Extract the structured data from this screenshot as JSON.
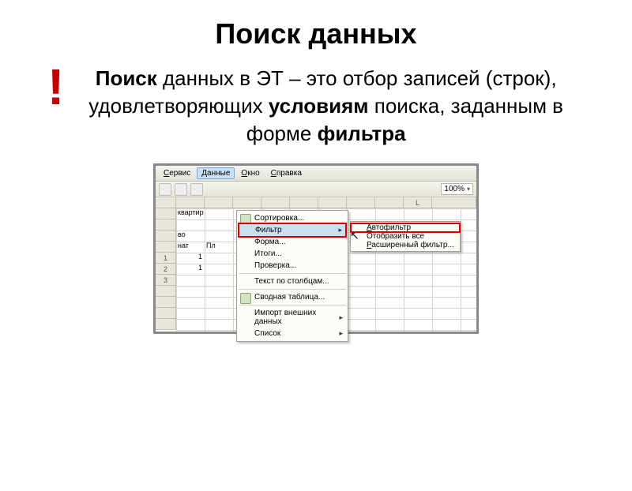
{
  "title": "Поиск данных",
  "bang": "!",
  "para_html": {
    "w1": "Поиск",
    "t1": " данных в ЭТ – это отбор записей (строк), удовлетворяющих ",
    "w2": "условиям",
    "t2": " поиска, заданным в форме ",
    "w3": "фильтра"
  },
  "menubar": {
    "service": "Сервис",
    "data": "Данные",
    "window": "Окно",
    "help": "Справка"
  },
  "zoom": "100%",
  "dropdown": {
    "sort": "Сортировка...",
    "filter": "Фильтр",
    "form": "Форма...",
    "totals": "Итоги...",
    "validate": "Проверка...",
    "textcols": "Текст по столбцам...",
    "pivot": "Сводная таблица...",
    "external": "Импорт внешних данных",
    "list": "Список"
  },
  "submenu": {
    "autofilter": "Автофильтр",
    "showall": "Отобразить все",
    "advanced": "Расширенный фильтр..."
  },
  "sheet": {
    "a1": "квартир",
    "a3": "во",
    "a4": "нат",
    "b4": "Пл",
    "r5": "1",
    "r6": "2",
    "r7": "3",
    "rownum5": "1",
    "rownum6": "1",
    "col_L": "L"
  }
}
